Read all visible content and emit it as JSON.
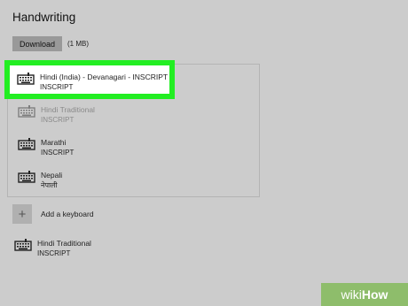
{
  "section": {
    "title": "Handwriting"
  },
  "download": {
    "button_label": "Download",
    "size": "(1 MB)"
  },
  "keyboards": [
    {
      "title": "Hindi (India) - Devanagari - INSCRIPT",
      "sub": "INSCRIPT"
    },
    {
      "title": "Hindi Traditional",
      "sub": "INSCRIPT"
    },
    {
      "title": "Marathi",
      "sub": "INSCRIPT"
    },
    {
      "title": "Nepali",
      "sub": "नेपाली"
    }
  ],
  "add_keyboard": {
    "label": "Add a keyboard",
    "icon": "plus-icon"
  },
  "extra_keyboard": {
    "title": "Hindi Traditional",
    "sub": "INSCRIPT"
  },
  "watermark": {
    "wiki": "wiki",
    "how": "How"
  },
  "colors": {
    "highlight": "#22ee22",
    "background": "#cccccc",
    "watermark_bg": "#8ebd6b"
  }
}
